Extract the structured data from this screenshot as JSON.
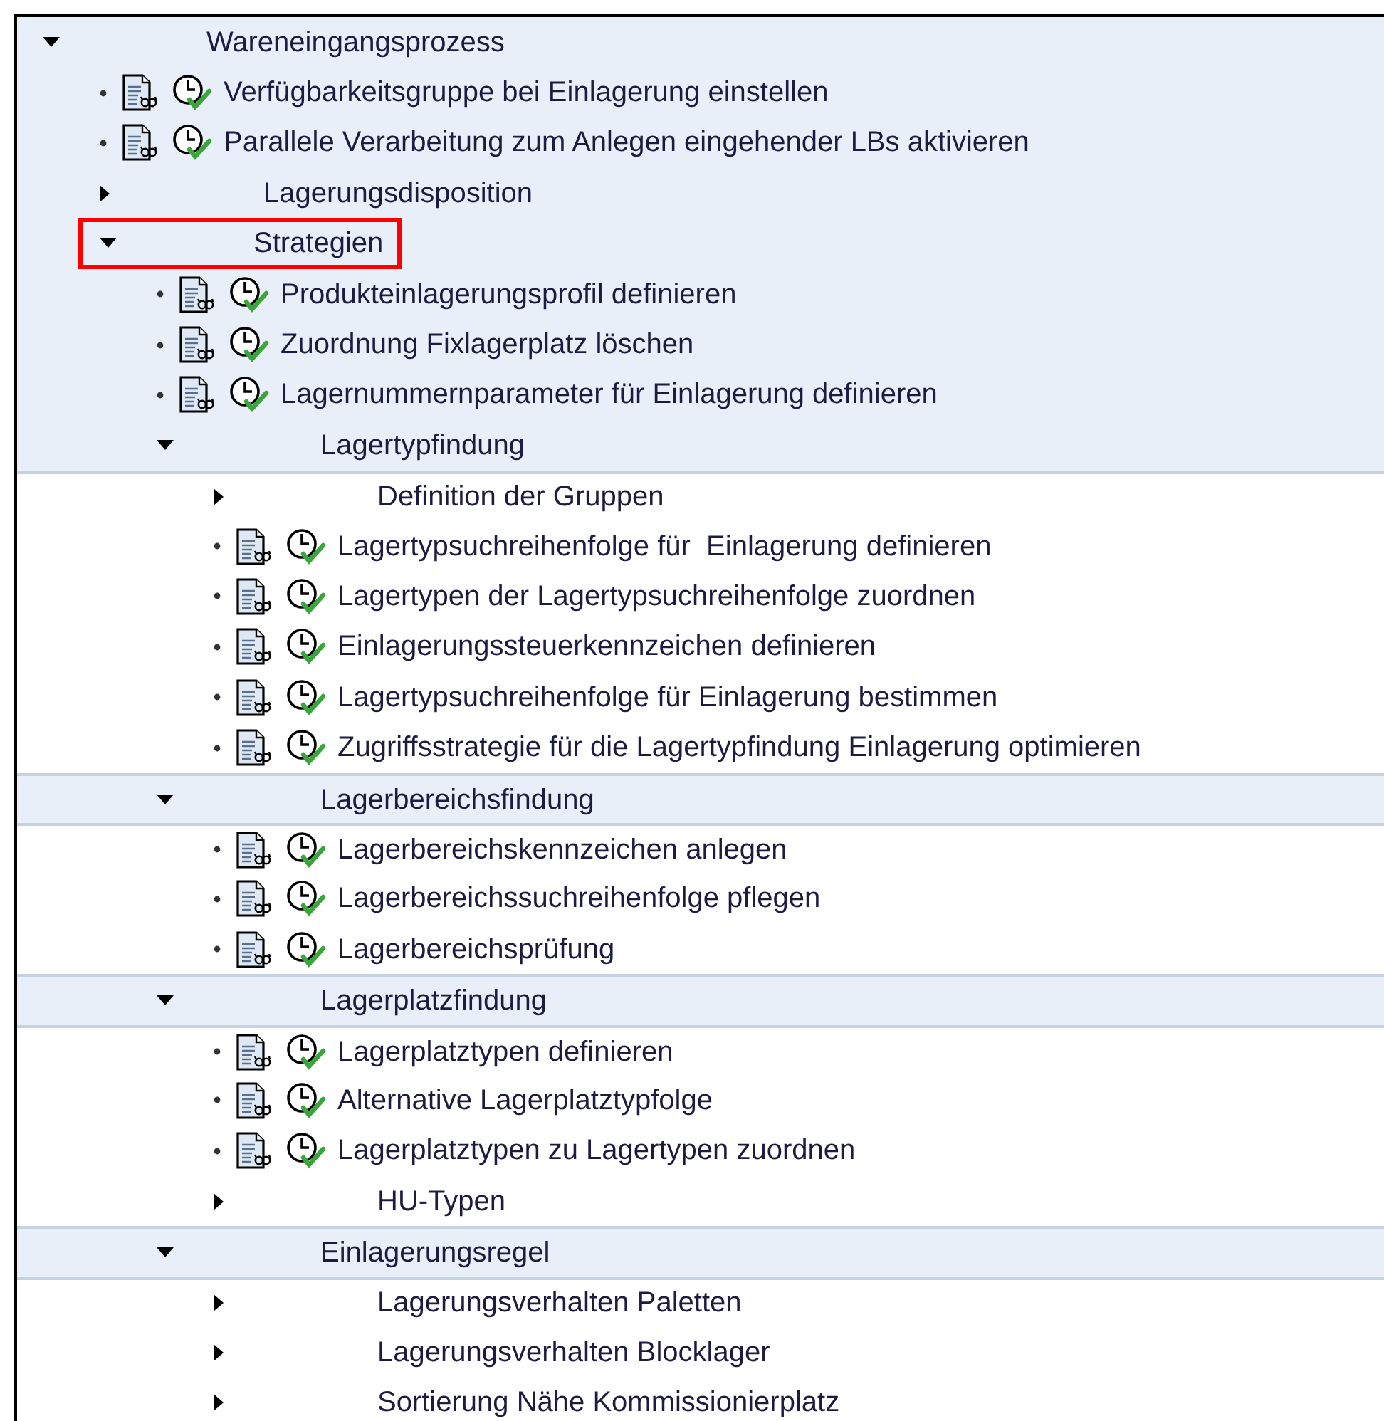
{
  "tree": [
    {
      "label": "Wareneingangsprozess",
      "kind": "folder",
      "expanded": true,
      "children": [
        {
          "label": "Verfügbarkeitsgruppe bei Einlagerung einstellen",
          "kind": "activity"
        },
        {
          "label": "Parallele Verarbeitung zum Anlegen eingehender LBs aktivieren",
          "kind": "activity"
        },
        {
          "label": "Lagerungsdisposition",
          "kind": "folder",
          "expanded": false
        },
        {
          "label": "Strategien",
          "kind": "folder",
          "expanded": true,
          "highlighted": true,
          "children": [
            {
              "label": "Produkteinlagerungsprofil definieren",
              "kind": "activity"
            },
            {
              "label": "Zuordnung Fixlagerplatz löschen",
              "kind": "activity"
            },
            {
              "label": "Lagernummernparameter für Einlagerung definieren",
              "kind": "activity"
            },
            {
              "label": "Lagertypfindung",
              "kind": "folder",
              "expanded": true,
              "children": [
                {
                  "label": "Definition der Gruppen",
                  "kind": "folder",
                  "expanded": false
                },
                {
                  "label": "Lagertypsuchreihenfolge für  Einlagerung definieren",
                  "kind": "activity"
                },
                {
                  "label": "Lagertypen der Lagertypsuchreihenfolge zuordnen",
                  "kind": "activity"
                },
                {
                  "label": "Einlagerungssteuerkennzeichen definieren",
                  "kind": "activity"
                },
                {
                  "label": "Lagertypsuchreihenfolge für Einlagerung bestimmen",
                  "kind": "activity"
                },
                {
                  "label": "Zugriffsstrategie für die Lagertypfindung Einlagerung optimieren",
                  "kind": "activity"
                }
              ]
            },
            {
              "label": "Lagerbereichsfindung",
              "kind": "folder",
              "expanded": true,
              "children": [
                {
                  "label": "Lagerbereichskennzeichen anlegen",
                  "kind": "activity"
                },
                {
                  "label": "Lagerbereichssuchreihenfolge pflegen",
                  "kind": "activity"
                },
                {
                  "label": "Lagerbereichsprüfung",
                  "kind": "activity"
                }
              ]
            },
            {
              "label": "Lagerplatzfindung",
              "kind": "folder",
              "expanded": true,
              "children": [
                {
                  "label": "Lagerplatztypen definieren",
                  "kind": "activity"
                },
                {
                  "label": "Alternative Lagerplatztypfolge",
                  "kind": "activity"
                },
                {
                  "label": "Lagerplatztypen zu Lagertypen zuordnen",
                  "kind": "activity"
                },
                {
                  "label": "HU-Typen",
                  "kind": "folder",
                  "expanded": false
                }
              ]
            },
            {
              "label": "Einlagerungsregel",
              "kind": "folder",
              "expanded": true,
              "children": [
                {
                  "label": "Lagerungsverhalten Paletten",
                  "kind": "folder",
                  "expanded": false
                },
                {
                  "label": "Lagerungsverhalten Blocklager",
                  "kind": "folder",
                  "expanded": false
                },
                {
                  "label": "Sortierung Nähe Kommissionierplatz",
                  "kind": "folder",
                  "expanded": false
                }
              ]
            }
          ]
        }
      ]
    }
  ]
}
